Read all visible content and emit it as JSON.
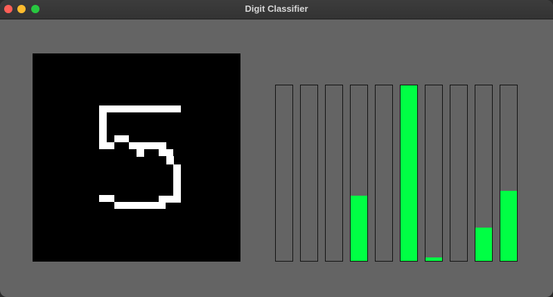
{
  "window": {
    "title": "Digit Classifier"
  },
  "colors": {
    "canvas_background": "#000000",
    "stroke": "#ffffff",
    "bar_fill": "#00ff44",
    "window_background": "#646464"
  },
  "drawing": {
    "digit_shown": "5"
  },
  "bars": [
    {
      "index": 0,
      "value": 0.0
    },
    {
      "index": 1,
      "value": 0.0
    },
    {
      "index": 2,
      "value": 0.0
    },
    {
      "index": 3,
      "value": 0.37
    },
    {
      "index": 4,
      "value": 0.0
    },
    {
      "index": 5,
      "value": 1.0
    },
    {
      "index": 6,
      "value": 0.02
    },
    {
      "index": 7,
      "value": 0.0
    },
    {
      "index": 8,
      "value": 0.19
    },
    {
      "index": 9,
      "value": 0.4
    }
  ]
}
